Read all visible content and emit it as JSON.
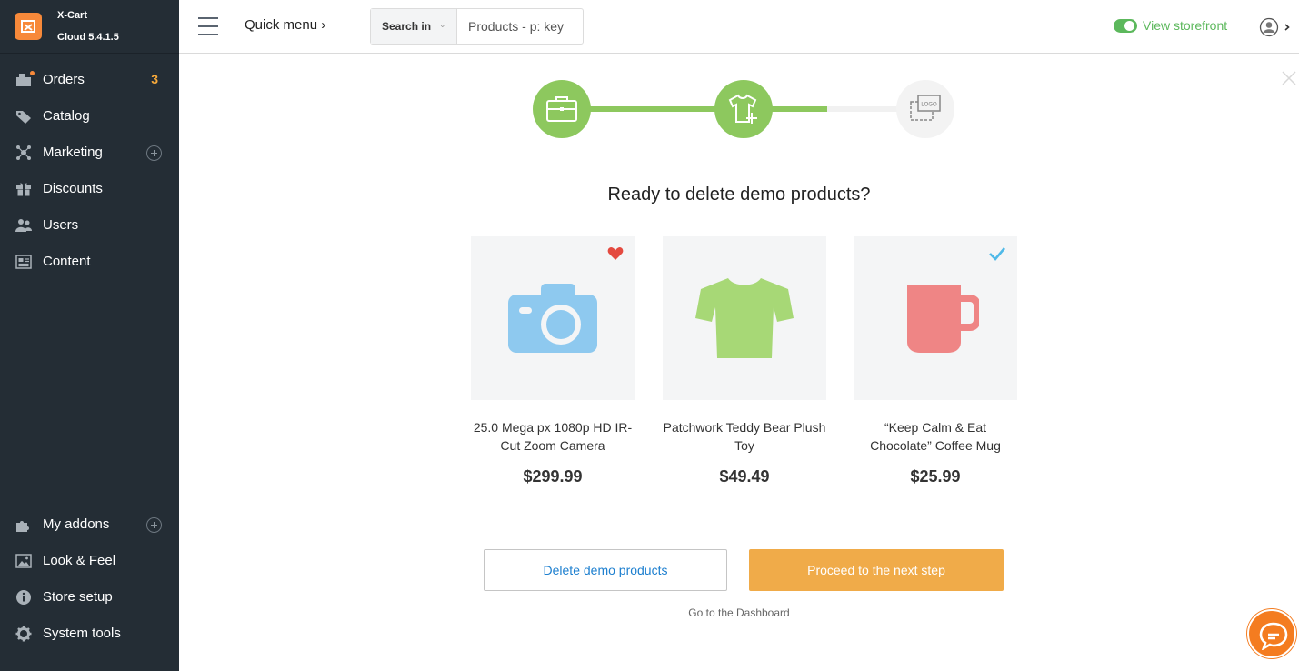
{
  "brand": {
    "name": "X-Cart",
    "version": "Cloud 5.4.1.5",
    "logo_color": "#f7893a"
  },
  "sidebar": {
    "items": [
      {
        "label": "Orders",
        "icon": "orders-icon",
        "badge": "3"
      },
      {
        "label": "Catalog",
        "icon": "tag-icon"
      },
      {
        "label": "Marketing",
        "icon": "marketing-icon"
      },
      {
        "label": "Discounts",
        "icon": "gift-icon"
      },
      {
        "label": "Users",
        "icon": "users-icon"
      },
      {
        "label": "Content",
        "icon": "content-icon"
      }
    ],
    "bottom_items": [
      {
        "label": "My addons",
        "icon": "puzzle-icon"
      },
      {
        "label": "Look & Feel",
        "icon": "image-icon"
      },
      {
        "label": "Store setup",
        "icon": "info-icon"
      },
      {
        "label": "System tools",
        "icon": "gear-icon"
      }
    ]
  },
  "topbar": {
    "quick_menu": "Quick menu ›",
    "search_in": "Search in",
    "search_placeholder": "Products - p: key",
    "storefront_label": "View storefront"
  },
  "wizard": {
    "title": "Ready to delete demo products?",
    "steps": [
      {
        "icon": "briefcase-icon",
        "done": true
      },
      {
        "icon": "tshirt-add-icon",
        "done": true
      },
      {
        "icon": "logo-placeholder-icon",
        "done": false
      }
    ],
    "products": [
      {
        "name": "25.0 Mega px 1080p HD IR-Cut Zoom Camera",
        "price": "$299.99",
        "icon": "camera-icon",
        "color": "#8ec9ef",
        "flag": "heart-icon"
      },
      {
        "name": "Patchwork Teddy Bear Plush Toy",
        "price": "$49.49",
        "icon": "tshirt-icon",
        "color": "#a7d876",
        "flag": ""
      },
      {
        "name": "“Keep Calm & Eat Chocolate” Coffee Mug",
        "price": "$25.99",
        "icon": "mug-icon",
        "color": "#ef8585",
        "flag": "check-icon"
      }
    ],
    "delete_button": "Delete demo products",
    "next_button": "Proceed to the next step",
    "dashboard_link": "Go to the Dashboard"
  },
  "colors": {
    "accent_green": "#8dc85e",
    "accent_orange": "#f0ab49",
    "sidebar_bg": "#242d35",
    "link_blue": "#1d7fcf"
  }
}
